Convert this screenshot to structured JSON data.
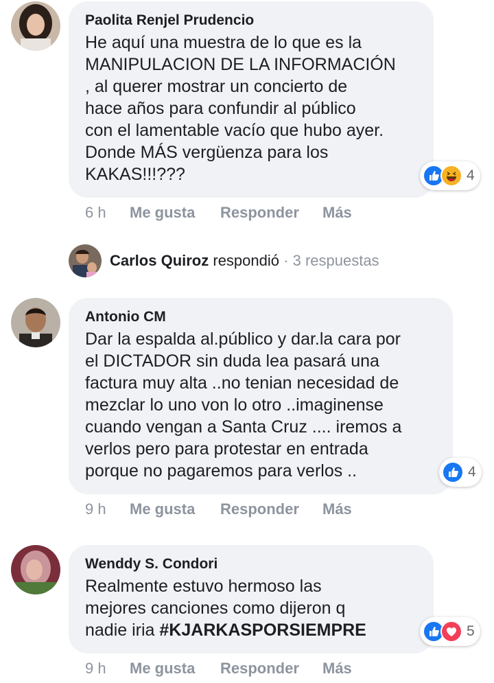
{
  "comments": [
    {
      "author": "Paolita Renjel Prudencio",
      "lines": [
        "He aquí una muestra de lo que es la",
        "MANIPULACION DE LA INFORMACIÓN",
        ", al querer mostrar un concierto de",
        "hace años para confundir al público",
        "con el lamentable vacío que hubo ayer.",
        "Donde MÁS vergüenza para los",
        "KAKAS!!!???"
      ],
      "reaction_count": "4",
      "reactions": [
        "like-icon",
        "haha-icon"
      ],
      "time": "6 h",
      "like": "Me gusta",
      "reply": "Responder",
      "more": "Más"
    },
    {
      "author": "Antonio CM",
      "lines": [
        "Dar la espalda al.público y dar.la cara por",
        "el DICTADOR sin duda lea pasará una",
        "factura muy alta ..no tenian necesidad de",
        "mezclar lo uno von lo otro ..imaginense",
        "cuando vengan a Santa Cruz .... iremos a",
        "verlos pero para protestar en entrada",
        "porque no pagaremos para verlos .."
      ],
      "reaction_count": "4",
      "reactions": [
        "like-icon"
      ],
      "time": "9 h",
      "like": "Me gusta",
      "reply": "Responder",
      "more": "Más"
    },
    {
      "author": "Wenddy S. Condori",
      "lines": [
        "Realmente estuvo hermoso las",
        "mejores canciones como dijeron q",
        "nadie iria "
      ],
      "hashtag": "#KJARKASPORSIEMPRE",
      "reaction_count": "5",
      "reactions": [
        "like-icon",
        "love-icon"
      ],
      "time": "9 h",
      "like": "Me gusta",
      "reply": "Responder",
      "more": "Más"
    }
  ],
  "reply_summary": {
    "name": "Carlos Quiroz",
    "verb": "respondió",
    "separator": "·",
    "count": "3 respuestas"
  },
  "colors": {
    "bubble": "#f0f2f5",
    "like": "#1877f2",
    "love": "#f33e58",
    "haha": "#f7b125",
    "muted": "#8d949e"
  }
}
